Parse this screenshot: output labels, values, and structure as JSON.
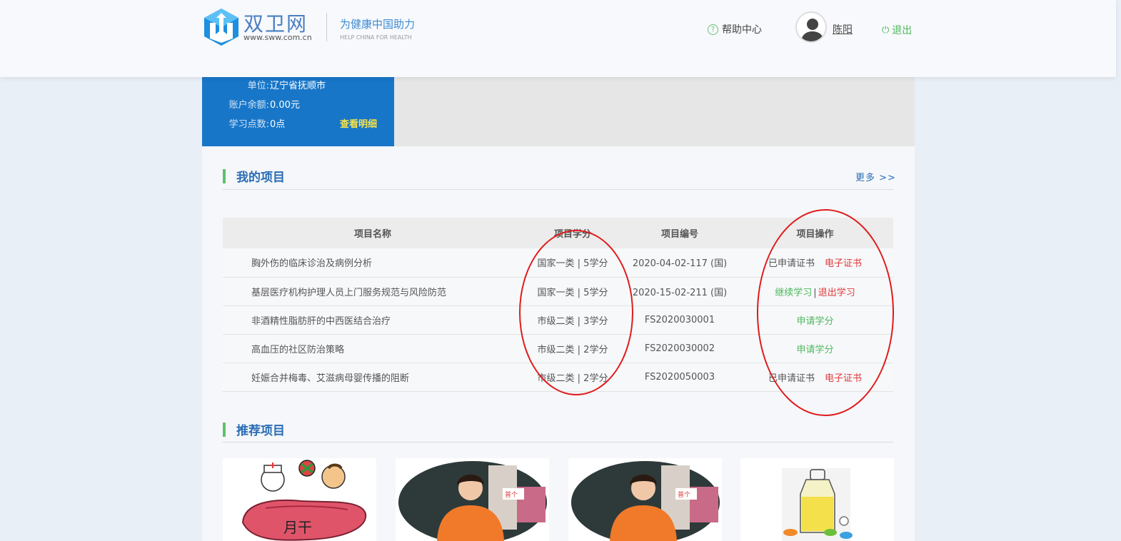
{
  "header": {
    "brand_name": "双卫网",
    "brand_url": "www.sww.com.cn",
    "slogan": "为健康中国助力",
    "slogan_en": "HELP CHINA FOR HEALTH",
    "help_label": "帮助中心",
    "username": "陈阳",
    "logout_label": "退出"
  },
  "info": {
    "unit_label": "单位:",
    "unit_value": "辽宁省抚顺市",
    "balance_label": "账户余额:",
    "balance_value": "0.00元",
    "points_label": "学习点数:",
    "points_value": "0点",
    "detail_link": "查看明细"
  },
  "my_projects": {
    "title": "我的项目",
    "more": "更多 >>",
    "columns": [
      "项目名称",
      "项目学分",
      "项目编号",
      "项目操作"
    ],
    "rows": [
      {
        "name": "胸外伤的临床诊治及病例分析",
        "credit": "国家一类 | 5学分",
        "code": "2020-04-02-117 (国)",
        "op1": "已申请证书",
        "op2": "电子证书"
      },
      {
        "name": "基层医疗机构护理人员上门服务规范与风险防范",
        "credit": "国家一类 | 5学分",
        "code": "2020-15-02-211 (国)",
        "op1": "继续学习",
        "sep": "|",
        "op2": "退出学习"
      },
      {
        "name": "非酒精性脂肪肝的中西医结合治疗",
        "credit": "市级二类 | 3学分",
        "code": "FS2020030001",
        "op1": "申请学分"
      },
      {
        "name": "高血压的社区防治策略",
        "credit": "市级二类 | 2学分",
        "code": "FS2020030002",
        "op1": "申请学分"
      },
      {
        "name": "妊娠合并梅毒、艾滋病母婴传播的阻断",
        "credit": "市级二类 | 2学分",
        "code": "FS2020050003",
        "op1": "已申请证书",
        "op2": "电子证书"
      }
    ]
  },
  "recommended": {
    "title": "推荐项目",
    "liver_text": "月干",
    "sign_text": "普个"
  },
  "colors": {
    "brand_blue": "#1876c8",
    "accent_green": "#4cb85c",
    "accent_red": "#e23a3a",
    "annotation_red": "#e01b1b"
  }
}
